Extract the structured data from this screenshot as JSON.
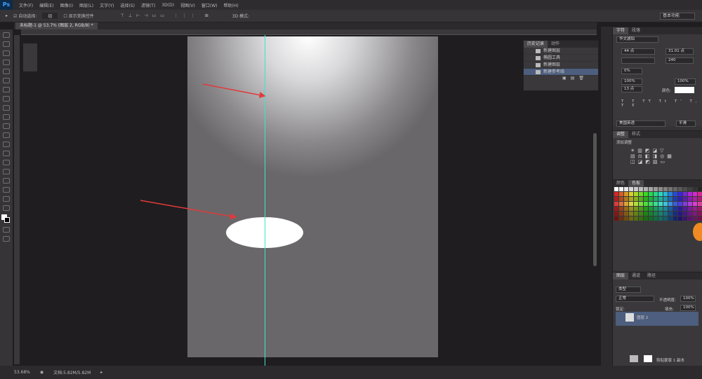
{
  "app": {
    "logo": "Ps",
    "workspace": "基本功能"
  },
  "menu": [
    "文件(F)",
    "编辑(E)",
    "图像(I)",
    "图层(L)",
    "文字(Y)",
    "选择(S)",
    "滤镜(T)",
    "3D(D)",
    "视图(V)",
    "窗口(W)",
    "帮助(H)"
  ],
  "options": {
    "auto_select": "自动选择:",
    "auto_select_value": "组",
    "show_transform": "显示变换控件",
    "mode_3d": "3D 模式:"
  },
  "document_tab": "未标题-1 @ 53.7% (图层 2, RGB/8) *",
  "history": {
    "tabs": [
      "历史记录",
      "动作"
    ],
    "items": [
      "新建图层",
      "椭圆工具",
      "新建图层",
      "新建参考线"
    ],
    "selected": 3
  },
  "character": {
    "tabs": [
      "字符",
      "段落"
    ],
    "font": "华文琥珀",
    "size": "44 点",
    "leading": "31.01 点",
    "tracking": "240",
    "scale_pct": "0%",
    "vscale": "100%",
    "hscale": "100%",
    "baseline": "13 点",
    "color_label": "颜色:",
    "antialias_lang": "美国英语",
    "antialias": "平滑",
    "color": "#ffffff"
  },
  "adjustments": {
    "tabs": [
      "调整",
      "样式"
    ],
    "title": "添加调整"
  },
  "swatches": {
    "tabs": [
      "颜色",
      "色板"
    ]
  },
  "layers": {
    "tabs": [
      "图层",
      "通道",
      "路径"
    ],
    "filter": "类型",
    "blend": "正常",
    "opacity_label": "不透明度:",
    "opacity": "100%",
    "lock_label": "锁定:",
    "fill_label": "填充:",
    "fill": "100%",
    "layer_name": "图层 2",
    "bottom_layer": "剪贴蒙版 1 副本"
  },
  "status": {
    "zoom": "53.68%",
    "doc": "文档:5.82M/5.82M"
  }
}
